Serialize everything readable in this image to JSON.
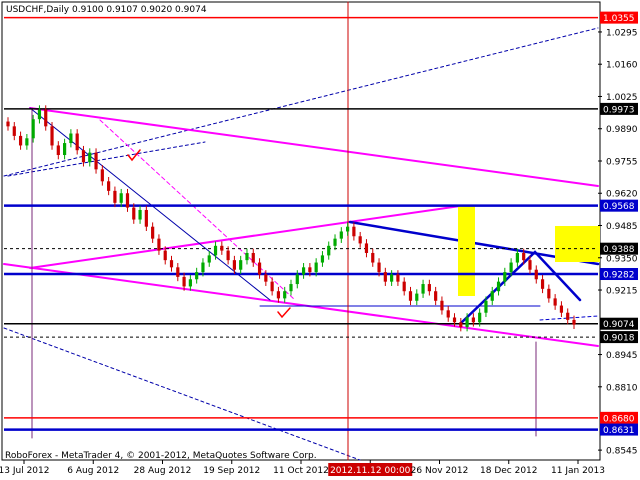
{
  "chart_data": {
    "type": "candlestick",
    "symbol_label": "USDCHF,Daily",
    "ohlc_label": "0.9100 0.9107 0.9020 0.9074",
    "ohlc": {
      "open": 0.91,
      "high": 0.9107,
      "low": 0.902,
      "close": 0.9074
    },
    "ylim": [
      0.8512,
      1.0412
    ],
    "y_ticks": [
      "1.0295",
      "1.0160",
      "1.0025",
      "0.9890",
      "0.9755",
      "0.9620",
      "0.9485",
      "0.9350",
      "0.9215",
      "0.8945",
      "0.8810",
      "0.8545"
    ],
    "x_ticks": [
      "13 Jul 2012",
      "6 Aug 2012",
      "28 Aug 2012",
      "19 Sep 2012",
      "11 Oct 2012",
      "2012.11.12 00:00",
      "26 Nov 2012",
      "18 Dec 2012",
      "11 Jan 2013"
    ],
    "highlighted_date": "2012.11.12 00:00",
    "price_levels": [
      {
        "label": "1.0355",
        "color": "#ff0000"
      },
      {
        "label": "0.9973",
        "color": "#000000"
      },
      {
        "label": "0.9568",
        "color": "#0000cc"
      },
      {
        "label": "0.9388",
        "color": "#000000"
      },
      {
        "label": "0.9282",
        "color": "#0000cc"
      },
      {
        "label": "0.9074",
        "color": "#000000"
      },
      {
        "label": "0.9018",
        "color": "#000000"
      },
      {
        "label": "0.8680",
        "color": "#ff0000"
      },
      {
        "label": "0.8631",
        "color": "#0000cc"
      }
    ],
    "watermark": "RoboForex - MetaTrader 4, © 2001-2012, MetaQuotes Software Corp.",
    "close_series": [
      0.99,
      0.986,
      0.982,
      0.985,
      0.993,
      0.997,
      0.99,
      0.982,
      0.978,
      0.983,
      0.987,
      0.98,
      0.975,
      0.979,
      0.972,
      0.967,
      0.963,
      0.958,
      0.962,
      0.956,
      0.951,
      0.955,
      0.948,
      0.943,
      0.938,
      0.934,
      0.931,
      0.927,
      0.923,
      0.926,
      0.929,
      0.933,
      0.936,
      0.94,
      0.938,
      0.934,
      0.93,
      0.934,
      0.937,
      0.933,
      0.928,
      0.925,
      0.921,
      0.918,
      0.921,
      0.924,
      0.928,
      0.931,
      0.929,
      0.933,
      0.936,
      0.94,
      0.943,
      0.946,
      0.948,
      0.944,
      0.941,
      0.937,
      0.933,
      0.929,
      0.925,
      0.928,
      0.925,
      0.921,
      0.917,
      0.92,
      0.924,
      0.921,
      0.917,
      0.913,
      0.91,
      0.908,
      0.906,
      0.91,
      0.908,
      0.912,
      0.917,
      0.921,
      0.925,
      0.929,
      0.933,
      0.937,
      0.934,
      0.93,
      0.926,
      0.922,
      0.918,
      0.915,
      0.912,
      0.909,
      0.907
    ]
  }
}
